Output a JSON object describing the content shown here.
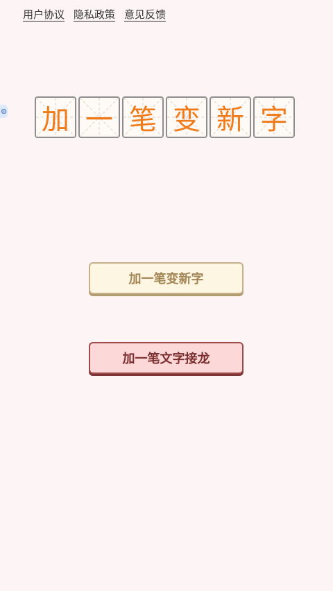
{
  "top_links": [
    {
      "label": "用户协议"
    },
    {
      "label": "隐私政策"
    },
    {
      "label": "意见反馈"
    }
  ],
  "title_chars": [
    "加",
    "一",
    "笔",
    "变",
    "新",
    "字"
  ],
  "buttons": {
    "new_char": "加一笔变新字",
    "char_chain": "加一笔文字接龙"
  },
  "colors": {
    "background": "#fdf5f5",
    "title_char": "#f07b1a",
    "btn_new_bg": "#fdf6e3",
    "btn_new_text": "#a48656",
    "btn_chain_bg": "#fdd8d8",
    "btn_chain_text": "#7a2e2e"
  }
}
